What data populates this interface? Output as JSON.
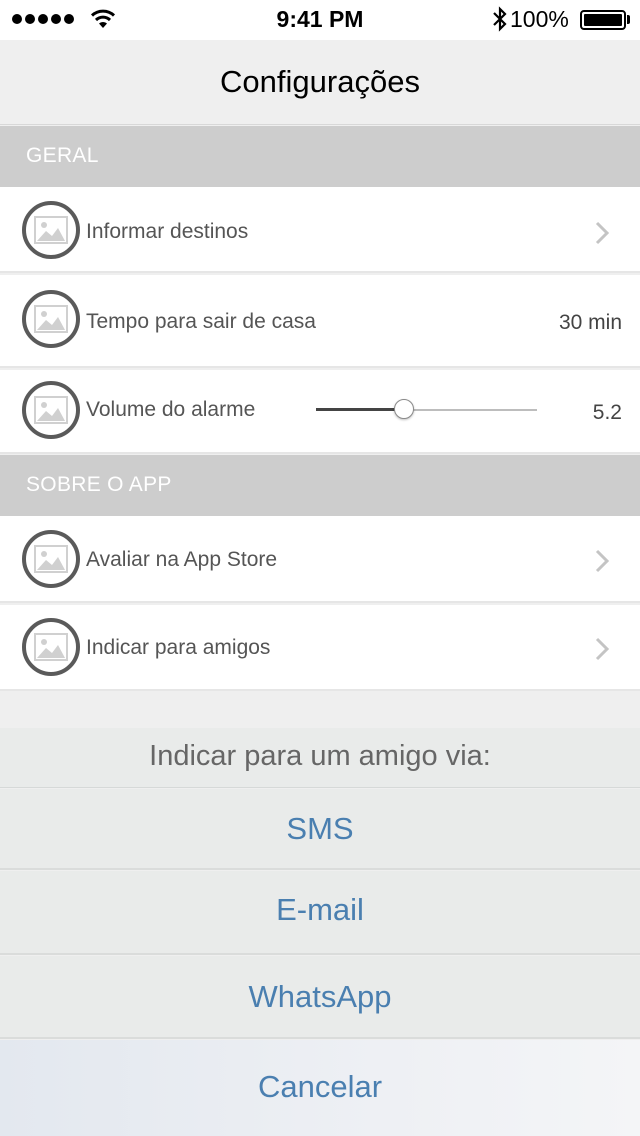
{
  "status_bar": {
    "time": "9:41 PM",
    "battery": "100%"
  },
  "nav": {
    "title": "Configurações"
  },
  "sections": {
    "geral": "GERAL",
    "sobre": "SOBRE O APP"
  },
  "rows": {
    "destinos": {
      "label": "Informar destinos"
    },
    "tempo": {
      "label": "Tempo para sair de casa",
      "value": "30 min"
    },
    "volume": {
      "label": "Volume do alarme",
      "value": "5.2",
      "slider_fraction": 0.4
    },
    "avaliar": {
      "label": "Avaliar na App Store"
    },
    "indicar": {
      "label": "Indicar para amigos"
    }
  },
  "action_sheet": {
    "title": "Indicar para um amigo via:",
    "sms": "SMS",
    "email": "E-mail",
    "whatsapp": "WhatsApp",
    "cancel": "Cancelar"
  },
  "colors": {
    "section_header_bg": "#cdcdcd",
    "action_text": "#4a7fb0"
  },
  "icons": {
    "row_icon": "image-placeholder-icon",
    "chevron": "chevron-right-icon"
  }
}
